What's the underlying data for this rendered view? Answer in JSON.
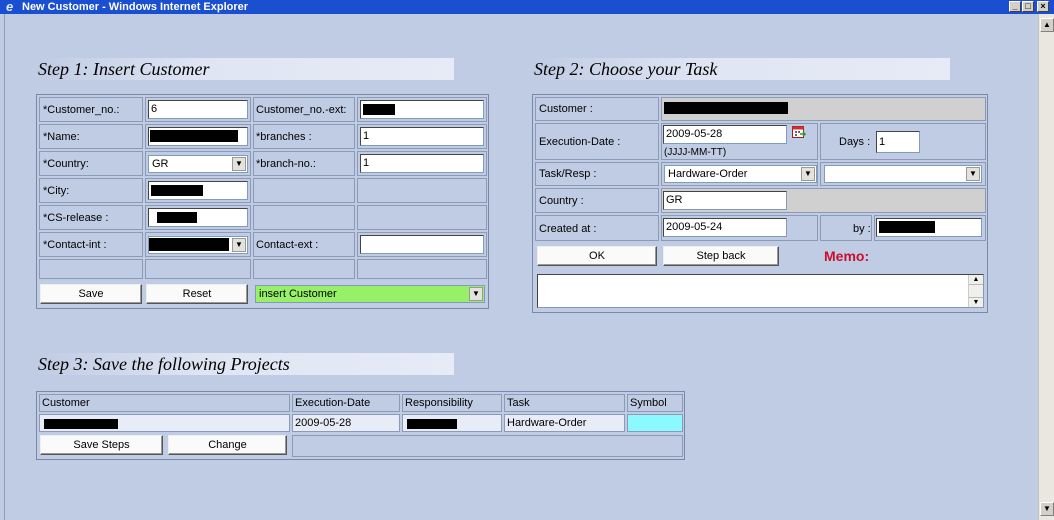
{
  "window": {
    "title": "New Customer - Windows Internet Explorer"
  },
  "step1": {
    "heading": "Step 1: Insert Customer",
    "customer_no_label": "*Customer_no.:",
    "customer_no_value": "6",
    "customer_no_ext_label": "Customer_no.-ext:",
    "name_label": "*Name:",
    "branches_label": "*branches :",
    "branches_value": "1",
    "country_label": "*Country:",
    "country_value": "GR",
    "branch_no_label": "*branch-no.:",
    "branch_no_value": "1",
    "city_label": "*City:",
    "cs_release_label": "*CS-release :",
    "contact_int_label": "*Contact-int :",
    "contact_ext_label": "Contact-ext :",
    "contact_ext_value": "",
    "save_label": "Save",
    "reset_label": "Reset",
    "action_value": "insert Customer",
    "action_color": "#98f068"
  },
  "step2": {
    "heading": "Step 2: Choose your Task",
    "customer_label": "Customer :",
    "execution_date_label": "Execution-Date :",
    "execution_date_value": "2009-05-28",
    "date_format_hint": "(JJJJ-MM-TT)",
    "days_label": "Days :",
    "days_value": "1",
    "task_resp_label": "Task/Resp :",
    "task_value": "Hardware-Order",
    "resp_value": "",
    "country_label": "Country :",
    "country_value": "GR",
    "created_at_label": "Created at :",
    "created_at_value": "2009-05-24",
    "by_label": "by :",
    "ok_label": "OK",
    "step_back_label": "Step back",
    "memo_label": "Memo:",
    "memo_color": "#c8102e"
  },
  "step3": {
    "heading": "Step 3: Save the following Projects",
    "columns": [
      "Customer",
      "Execution-Date",
      "Responsibility",
      "Task",
      "Symbol"
    ],
    "row": {
      "execution_date": "2009-05-28",
      "task": "Hardware-Order",
      "symbol_color": "#8cf8ff"
    },
    "save_steps_label": "Save Steps",
    "change_label": "Change"
  }
}
